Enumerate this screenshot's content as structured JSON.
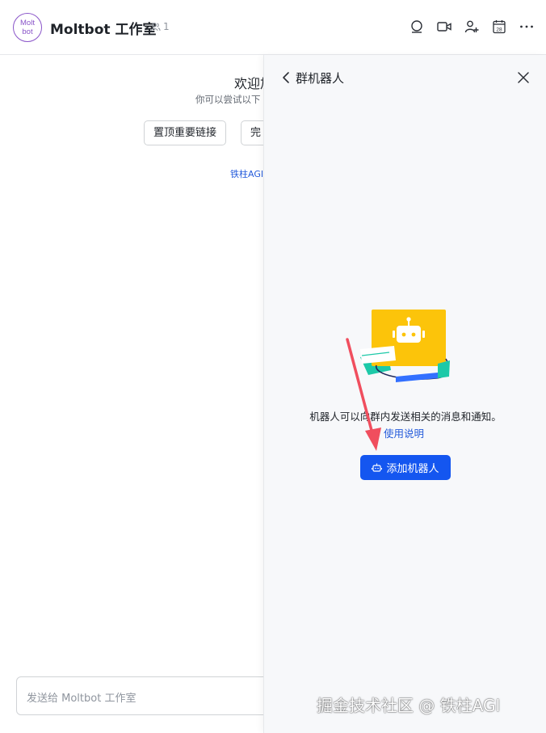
{
  "header": {
    "avatar_text": "Molt\nbot",
    "avatar_line1": "Molt",
    "avatar_line2": "bot",
    "title": "Moltbot 工作室",
    "member_count": "1",
    "icons": [
      "search-icon",
      "video-icon",
      "add-member-icon",
      "calendar-icon",
      "more-icon"
    ],
    "calendar_day": "28"
  },
  "chat": {
    "welcome": "欢迎加",
    "welcome_sub": "你可以尝试以下",
    "quick_buttons": [
      "置顶重要链接",
      "完"
    ],
    "link_text": "铁柱AGI",
    "input_placeholder": "发送给 Moltbot 工作室"
  },
  "panel": {
    "title": "群机器人",
    "description": "机器人可以向群内发送相关的消息和通知。",
    "guide_link": "使用说明",
    "add_button": "添加机器人"
  },
  "colors": {
    "accent": "#1456f0",
    "link": "#245bdb",
    "avatar": "#8a55c9",
    "bot_yellow": "#fcc40a",
    "bot_teal": "#1dc9a8",
    "arrow": "#f04e5e"
  },
  "watermark": "掘金技术社区 @ 铁柱AGI"
}
